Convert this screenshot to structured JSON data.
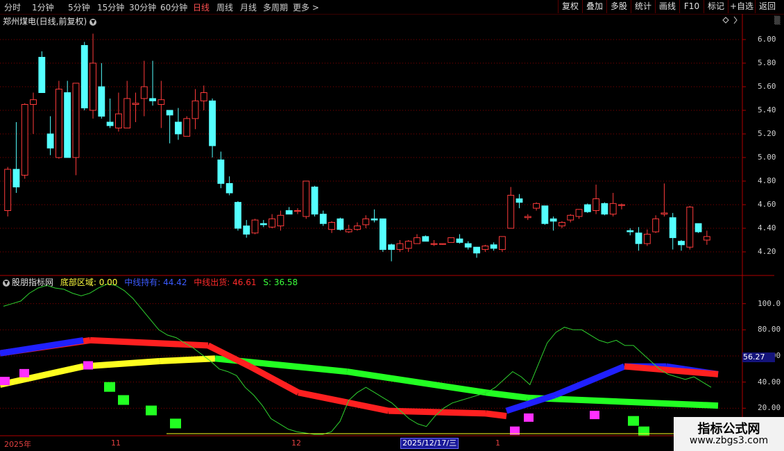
{
  "toolbar": {
    "timeframes": [
      "分时",
      "1分钟",
      "5分钟",
      "15分钟",
      "30分钟",
      "60分钟",
      "日线",
      "周线",
      "月线",
      "多周期",
      "更多 >"
    ],
    "active": "日线",
    "right_buttons": [
      "复权",
      "叠加",
      "多股",
      "统计",
      "画线",
      "F10",
      "标记",
      "+自选",
      "返回"
    ]
  },
  "main_chart": {
    "title": "郑州煤电(日线,前复权)",
    "y_ticks": [
      "6.00",
      "5.80",
      "5.60",
      "5.40",
      "5.20",
      "5.00",
      "4.80",
      "4.60",
      "4.40",
      "4.20"
    ]
  },
  "indicator": {
    "name": "股朋指标网",
    "zone_label": "底部区域: 0.00",
    "mid_hold_label": "中线持有: 44.42",
    "mid_exit_label": "中线出货: 46.61",
    "s_label": "S: 36.58",
    "y_ticks": [
      "100.0",
      "80.00",
      "60.00",
      "40.00",
      "20.00"
    ],
    "current_value": "56.27"
  },
  "x_axis": {
    "labels": [
      "2025年",
      "11",
      "12",
      "1"
    ],
    "cursor_date": "2025/12/17/三"
  },
  "watermark": {
    "line1": "指标公式网",
    "line2": "www.zbgs3.com"
  },
  "colors": {
    "up": "#ff3b3b",
    "down": "#54ffff",
    "grid": "#8a0000",
    "signal": "#2fd22f"
  },
  "chart_data": {
    "type": "candlestick",
    "ylim": [
      4.1,
      6.1
    ],
    "candles": [
      [
        4.55,
        4.9,
        4.5,
        4.92
      ],
      [
        4.9,
        4.75,
        4.7,
        5.3
      ],
      [
        4.85,
        5.45,
        4.82,
        5.46
      ],
      [
        5.45,
        5.49,
        5.2,
        5.55
      ],
      [
        5.85,
        5.55,
        5.55,
        5.9
      ],
      [
        5.2,
        5.08,
        5.02,
        5.35
      ],
      [
        5.0,
        5.58,
        4.99,
        5.65
      ],
      [
        5.55,
        5.0,
        5.0,
        5.65
      ],
      [
        5.0,
        5.63,
        4.85,
        5.63
      ],
      [
        5.95,
        5.42,
        5.4,
        5.98
      ],
      [
        5.4,
        5.8,
        5.33,
        6.05
      ],
      [
        5.6,
        5.35,
        5.33,
        5.8
      ],
      [
        5.3,
        5.27,
        5.25,
        5.5
      ],
      [
        5.25,
        5.37,
        5.22,
        5.55
      ],
      [
        5.25,
        5.5,
        5.25,
        5.65
      ],
      [
        5.45,
        5.46,
        5.3,
        5.55
      ],
      [
        5.5,
        5.6,
        5.35,
        5.82
      ],
      [
        5.5,
        5.48,
        5.44,
        5.82
      ],
      [
        5.45,
        5.49,
        5.25,
        5.65
      ],
      [
        5.4,
        5.36,
        5.12,
        5.4
      ],
      [
        5.3,
        5.2,
        5.15,
        5.42
      ],
      [
        5.18,
        5.33,
        5.18,
        5.35
      ],
      [
        5.33,
        5.48,
        5.24,
        5.58
      ],
      [
        5.48,
        5.55,
        5.4,
        5.61
      ],
      [
        5.48,
        5.1,
        5.0,
        5.5
      ],
      [
        4.98,
        4.78,
        4.74,
        5.05
      ],
      [
        4.78,
        4.7,
        4.68,
        4.84
      ],
      [
        4.62,
        4.4,
        4.38,
        4.63
      ],
      [
        4.42,
        4.35,
        4.32,
        4.47
      ],
      [
        4.36,
        4.47,
        4.35,
        4.48
      ],
      [
        4.44,
        4.43,
        4.41,
        4.47
      ],
      [
        4.41,
        4.48,
        4.4,
        4.52
      ],
      [
        4.42,
        4.51,
        4.38,
        4.55
      ],
      [
        4.55,
        4.52,
        4.52,
        4.58
      ],
      [
        4.55,
        4.55,
        4.52,
        4.57
      ],
      [
        4.5,
        4.8,
        4.48,
        4.8
      ],
      [
        4.75,
        4.52,
        4.5,
        4.76
      ],
      [
        4.52,
        4.44,
        4.42,
        4.55
      ],
      [
        4.39,
        4.45,
        4.36,
        4.46
      ],
      [
        4.48,
        4.39,
        4.38,
        4.49
      ],
      [
        4.37,
        4.39,
        4.36,
        4.43
      ],
      [
        4.39,
        4.42,
        4.38,
        4.45
      ],
      [
        4.43,
        4.48,
        4.4,
        4.51
      ],
      [
        4.48,
        4.47,
        4.45,
        4.56
      ],
      [
        4.48,
        4.22,
        4.2,
        4.48
      ],
      [
        4.26,
        4.22,
        4.12,
        4.27
      ],
      [
        4.22,
        4.27,
        4.2,
        4.3
      ],
      [
        4.23,
        4.29,
        4.2,
        4.3
      ],
      [
        4.27,
        4.32,
        4.27,
        4.35
      ],
      [
        4.33,
        4.29,
        4.29,
        4.34
      ],
      [
        4.27,
        4.27,
        4.25,
        4.3
      ],
      [
        4.27,
        4.27,
        4.26,
        4.27
      ],
      [
        4.28,
        4.32,
        4.28,
        4.32
      ],
      [
        4.31,
        4.28,
        4.27,
        4.35
      ],
      [
        4.27,
        4.24,
        4.22,
        4.29
      ],
      [
        4.24,
        4.19,
        4.15,
        4.24
      ],
      [
        4.22,
        4.25,
        4.2,
        4.26
      ],
      [
        4.26,
        4.23,
        4.21,
        4.28
      ],
      [
        4.22,
        4.33,
        4.2,
        4.33
      ],
      [
        4.4,
        4.68,
        4.4,
        4.75
      ],
      [
        4.65,
        4.62,
        4.57,
        4.69
      ],
      [
        4.49,
        4.5,
        4.47,
        4.52
      ],
      [
        4.57,
        4.61,
        4.55,
        4.62
      ],
      [
        4.59,
        4.44,
        4.43,
        4.59
      ],
      [
        4.48,
        4.46,
        4.38,
        4.5
      ],
      [
        4.42,
        4.45,
        4.4,
        4.46
      ],
      [
        4.47,
        4.51,
        4.45,
        4.52
      ],
      [
        4.5,
        4.56,
        4.48,
        4.56
      ],
      [
        4.6,
        4.54,
        4.53,
        4.61
      ],
      [
        4.55,
        4.65,
        4.52,
        4.77
      ],
      [
        4.61,
        4.52,
        4.51,
        4.62
      ],
      [
        4.52,
        4.61,
        4.5,
        4.7
      ],
      [
        4.6,
        4.6,
        4.56,
        4.61
      ],
      [
        4.38,
        4.37,
        4.34,
        4.4
      ],
      [
        4.36,
        4.27,
        4.21,
        4.41
      ],
      [
        4.27,
        4.35,
        4.25,
        4.39
      ],
      [
        4.37,
        4.48,
        4.36,
        4.51
      ],
      [
        4.52,
        4.53,
        4.5,
        4.78
      ],
      [
        4.49,
        4.32,
        4.22,
        4.53
      ],
      [
        4.29,
        4.26,
        4.21,
        4.3
      ],
      [
        4.24,
        4.58,
        4.22,
        4.59
      ],
      [
        4.44,
        4.37,
        4.36,
        4.44
      ],
      [
        4.3,
        4.33,
        4.26,
        4.38
      ]
    ],
    "indicator_series": {
      "ylim": [
        0,
        120
      ],
      "s_line": [
        98,
        100,
        102,
        108,
        112,
        114,
        112,
        111,
        108,
        106,
        108,
        112,
        115,
        114,
        110,
        104,
        96,
        88,
        80,
        76,
        74,
        70,
        66,
        61,
        56,
        50,
        48,
        45,
        36,
        30,
        22,
        12,
        8,
        4,
        2,
        1,
        0,
        0,
        2,
        10,
        26,
        32,
        36,
        32,
        28,
        24,
        18,
        12,
        8,
        6,
        14,
        20,
        24,
        26,
        28,
        30,
        32,
        36,
        42,
        48,
        44,
        38,
        54,
        70,
        78,
        82,
        80,
        80,
        76,
        72,
        70,
        72,
        68,
        68,
        62,
        56,
        50,
        46,
        44,
        42,
        44,
        40,
        36
      ]
    }
  }
}
